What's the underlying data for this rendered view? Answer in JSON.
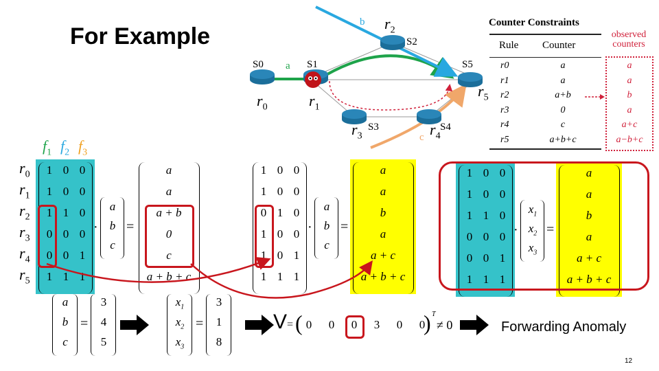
{
  "slide": {
    "title": "For Example",
    "page_number": "12"
  },
  "network": {
    "switches": [
      {
        "id": "S0",
        "rule": "r",
        "rule_sub": "0"
      },
      {
        "id": "S1",
        "rule": "r",
        "rule_sub": "1"
      },
      {
        "id": "S2",
        "rule": "r",
        "rule_sub": "2"
      },
      {
        "id": "S3",
        "rule": "r",
        "rule_sub": "3"
      },
      {
        "id": "S4",
        "rule": "r",
        "rule_sub": "4"
      },
      {
        "id": "S5",
        "rule": "r",
        "rule_sub": "5"
      }
    ],
    "flows": [
      {
        "label": "a",
        "color": "#1ea34a"
      },
      {
        "label": "b",
        "color": "#29a8e0"
      },
      {
        "label": "c",
        "color": "#f0a76a"
      }
    ],
    "colors": {
      "switch": "#1b6e9a",
      "anomaly_path": "#d0203a"
    }
  },
  "counter_table": {
    "title": "Counter Constraints",
    "headers": [
      "Rule",
      "Counter"
    ],
    "rows": [
      {
        "rule": "r0",
        "counter": "a"
      },
      {
        "rule": "r1",
        "counter": "a"
      },
      {
        "rule": "r2",
        "counter": "a+b"
      },
      {
        "rule": "r3",
        "counter": "0"
      },
      {
        "rule": "r4",
        "counter": "c"
      },
      {
        "rule": "r5",
        "counter": "a+b+c"
      }
    ],
    "observed_label_1": "observed",
    "observed_label_2": "counters",
    "observed": [
      "a",
      "a",
      "b",
      "a",
      "a+c",
      "a−b+c"
    ]
  },
  "equation1": {
    "flow_headers": [
      {
        "label": "f",
        "sub": "1",
        "color": "#1ea34a"
      },
      {
        "label": "f",
        "sub": "2",
        "color": "#29a8e0"
      },
      {
        "label": "f",
        "sub": "3",
        "color": "#f0a020"
      }
    ],
    "row_labels": [
      "0",
      "1",
      "2",
      "3",
      "4",
      "5"
    ],
    "matrix": [
      [
        "1",
        "0",
        "0"
      ],
      [
        "1",
        "0",
        "0"
      ],
      [
        "1",
        "1",
        "0"
      ],
      [
        "0",
        "0",
        "0"
      ],
      [
        "0",
        "0",
        "1"
      ],
      [
        "1",
        "1",
        "1"
      ]
    ],
    "vector": [
      "a",
      "b",
      "c"
    ],
    "result": [
      "a",
      "a",
      "a + b",
      "0",
      "c",
      "a + b + c"
    ]
  },
  "equation2": {
    "matrix": [
      [
        "1",
        "0",
        "0"
      ],
      [
        "1",
        "0",
        "0"
      ],
      [
        "0",
        "1",
        "0"
      ],
      [
        "1",
        "0",
        "0"
      ],
      [
        "1",
        "0",
        "1"
      ],
      [
        "1",
        "1",
        "1"
      ]
    ],
    "vector": [
      "a",
      "b",
      "c"
    ],
    "result": [
      "a",
      "a",
      "b",
      "a",
      "a + c",
      "a + b + c"
    ]
  },
  "equation3": {
    "matrix": [
      [
        "1",
        "0",
        "0"
      ],
      [
        "1",
        "0",
        "0"
      ],
      [
        "1",
        "1",
        "0"
      ],
      [
        "0",
        "0",
        "0"
      ],
      [
        "0",
        "0",
        "1"
      ],
      [
        "1",
        "1",
        "1"
      ]
    ],
    "vector": [
      "x",
      "x",
      "x"
    ],
    "vector_subs": [
      "1",
      "2",
      "3"
    ],
    "result": [
      "a",
      "a",
      "b",
      "a",
      "a + c",
      "a + b + c"
    ]
  },
  "bottom": {
    "abc_vector": [
      "a",
      "b",
      "c"
    ],
    "abc_values": [
      "3",
      "4",
      "5"
    ],
    "x_vector": [
      "x",
      "x",
      "x"
    ],
    "x_subs": [
      "1",
      "2",
      "3"
    ],
    "x_values": [
      "3",
      "1",
      "8"
    ],
    "v_label": "V",
    "v_eq": "=",
    "v_values": [
      "0",
      "0",
      "0",
      "3",
      "0",
      "0"
    ],
    "v_transpose": "T",
    "v_neq": "≠ 0",
    "conclusion": "Forwarding Anomaly"
  },
  "operators": {
    "dot": "·",
    "equals": "="
  }
}
